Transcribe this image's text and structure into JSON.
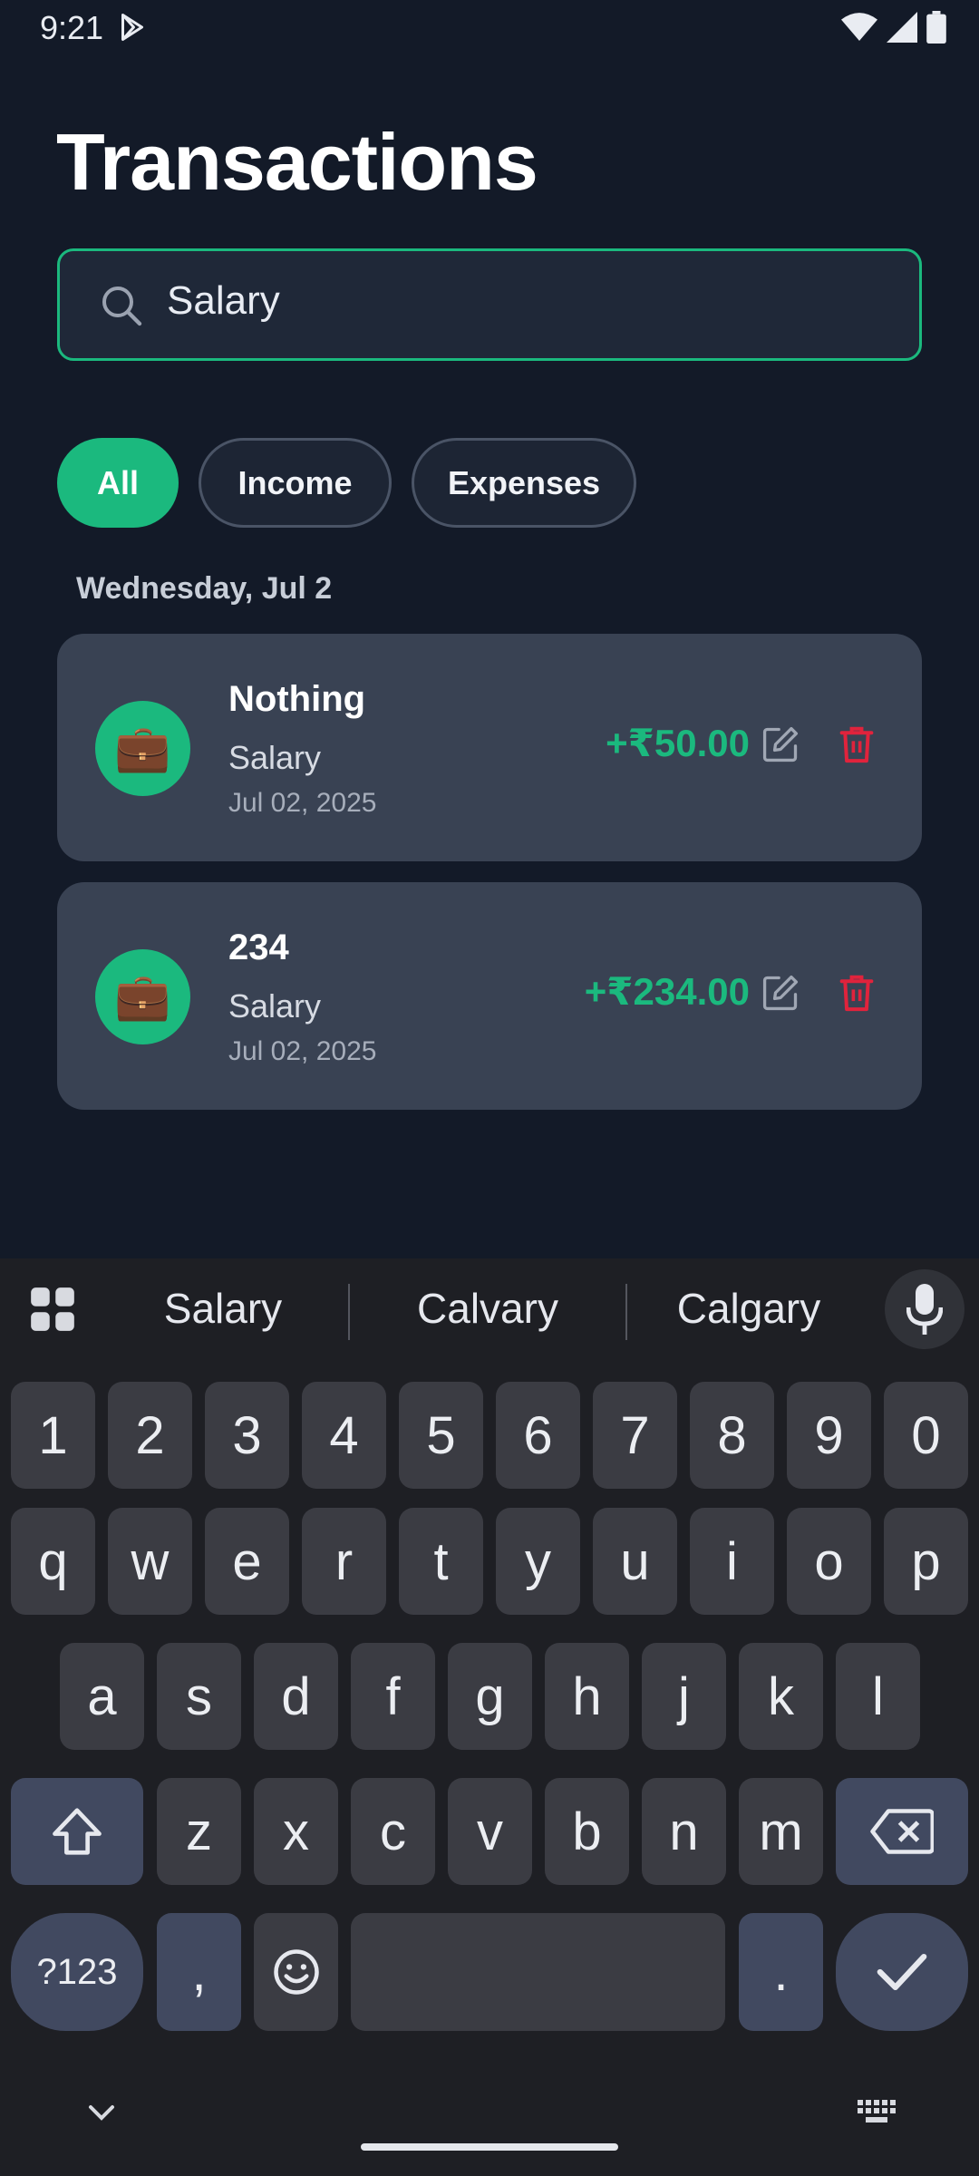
{
  "status_bar": {
    "time": "9:21"
  },
  "page": {
    "title": "Transactions"
  },
  "search": {
    "value": "Salary"
  },
  "filters": [
    {
      "label": "All",
      "active": true
    },
    {
      "label": "Income",
      "active": false
    },
    {
      "label": "Expenses",
      "active": false
    }
  ],
  "group": {
    "date_header": "Wednesday, Jul 2"
  },
  "transactions": [
    {
      "title": "Nothing",
      "category": "Salary",
      "date": "Jul 02, 2025",
      "amount": "+₹50.00",
      "icon": "briefcase-icon"
    },
    {
      "title": "234",
      "category": "Salary",
      "date": "Jul 02, 2025",
      "amount": "+₹234.00",
      "icon": "briefcase-icon"
    }
  ],
  "keyboard": {
    "suggestions": [
      "Salary",
      "Calvary",
      "Calgary"
    ],
    "row_numbers": [
      "1",
      "2",
      "3",
      "4",
      "5",
      "6",
      "7",
      "8",
      "9",
      "0"
    ],
    "row_q": [
      "q",
      "w",
      "e",
      "r",
      "t",
      "y",
      "u",
      "i",
      "o",
      "p"
    ],
    "row_a": [
      "a",
      "s",
      "d",
      "f",
      "g",
      "h",
      "j",
      "k",
      "l"
    ],
    "row_z": [
      "z",
      "x",
      "c",
      "v",
      "b",
      "n",
      "m"
    ],
    "symbols_label": "?123",
    "comma": ",",
    "period": "."
  },
  "colors": {
    "accent": "#1bb97e",
    "background": "#131a28",
    "card": "#394253",
    "danger": "#e0233c"
  }
}
